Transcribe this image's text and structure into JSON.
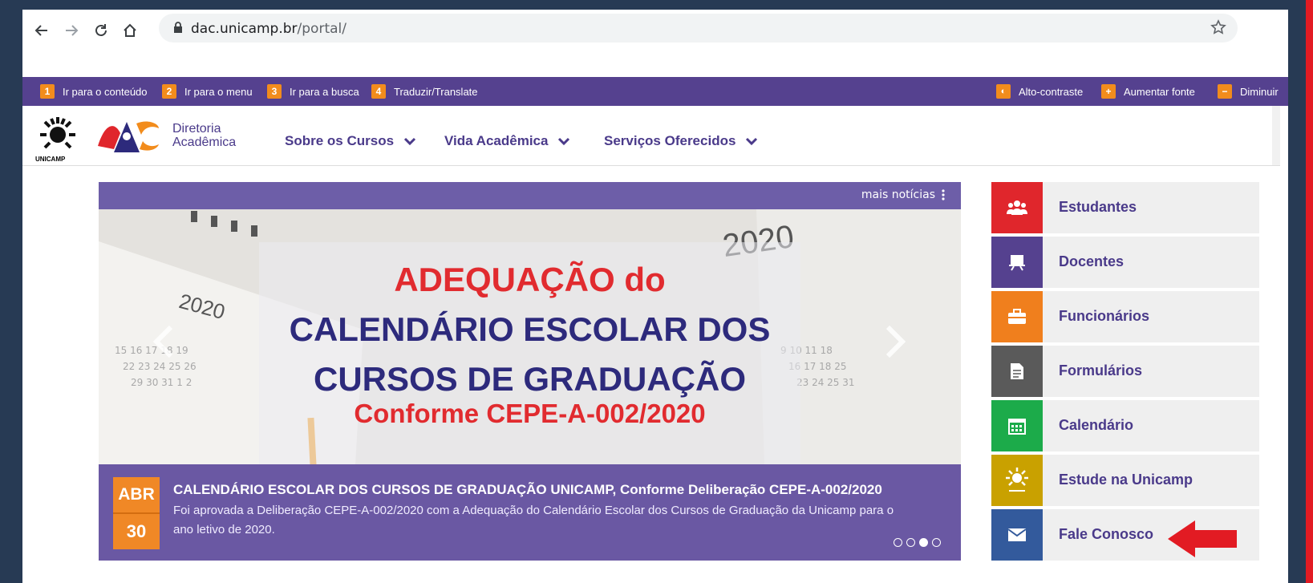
{
  "browser": {
    "url_host": "dac.unicamp.br",
    "url_path": "/portal/"
  },
  "accessibility": {
    "items": [
      {
        "num": "1",
        "label": "Ir para o conteúdo"
      },
      {
        "num": "2",
        "label": "Ir para o menu"
      },
      {
        "num": "3",
        "label": "Ir para a busca"
      },
      {
        "num": "4",
        "label": "Traduzir/Translate"
      }
    ],
    "alto_contraste": "Alto-contraste",
    "aumentar": "Aumentar fonte",
    "diminuir": "Diminuir"
  },
  "header": {
    "unicamp": "UNICAMP",
    "dac_line1": "Diretoria",
    "dac_line2": "Acadêmica",
    "menu": [
      "Sobre os Cursos",
      "Vida Acadêmica",
      "Serviços Oferecidos"
    ]
  },
  "carousel": {
    "more_news": "mais notícias",
    "slide": {
      "line1": "ADEQUAÇÃO do",
      "line2": "CALENDÁRIO ESCOLAR DOS",
      "line3": "CURSOS DE GRADUAÇÃO",
      "line4": "Conforme CEPE-A-002/2020",
      "year_a": "2020",
      "year_b": "2020"
    },
    "caption": {
      "month": "ABR",
      "day": "30",
      "title": "CALENDÁRIO ESCOLAR DOS CURSOS DE GRADUAÇÃO UNICAMP, Conforme Deliberação CEPE-A-002/2020",
      "description": "Foi aprovada a Deliberação CEPE-A-002/2020 com a Adequação do Calendário Escolar dos Cursos de Graduação da Unicamp para o ano letivo de 2020."
    },
    "active_dot": 3
  },
  "sidebar": {
    "items": [
      {
        "label": "Estudantes",
        "color": "#e0262c",
        "icon": "users-icon"
      },
      {
        "label": "Docentes",
        "color": "#55418f",
        "icon": "presentation-icon"
      },
      {
        "label": "Funcionários",
        "color": "#f07f1d",
        "icon": "briefcase-icon"
      },
      {
        "label": "Formulários",
        "color": "#5a5a5a",
        "icon": "document-icon"
      },
      {
        "label": "Calendário",
        "color": "#1cab4a",
        "icon": "calendar-icon"
      },
      {
        "label": "Estude na Unicamp",
        "color": "#c9a100",
        "icon": "unicamp-logo-icon"
      },
      {
        "label": "Fale Conosco",
        "color": "#335a9c",
        "icon": "envelope-icon"
      }
    ]
  },
  "colors": {
    "accent_purple": "#55418f",
    "orange": "#f28c1c",
    "annotation_red": "#e21b23"
  }
}
